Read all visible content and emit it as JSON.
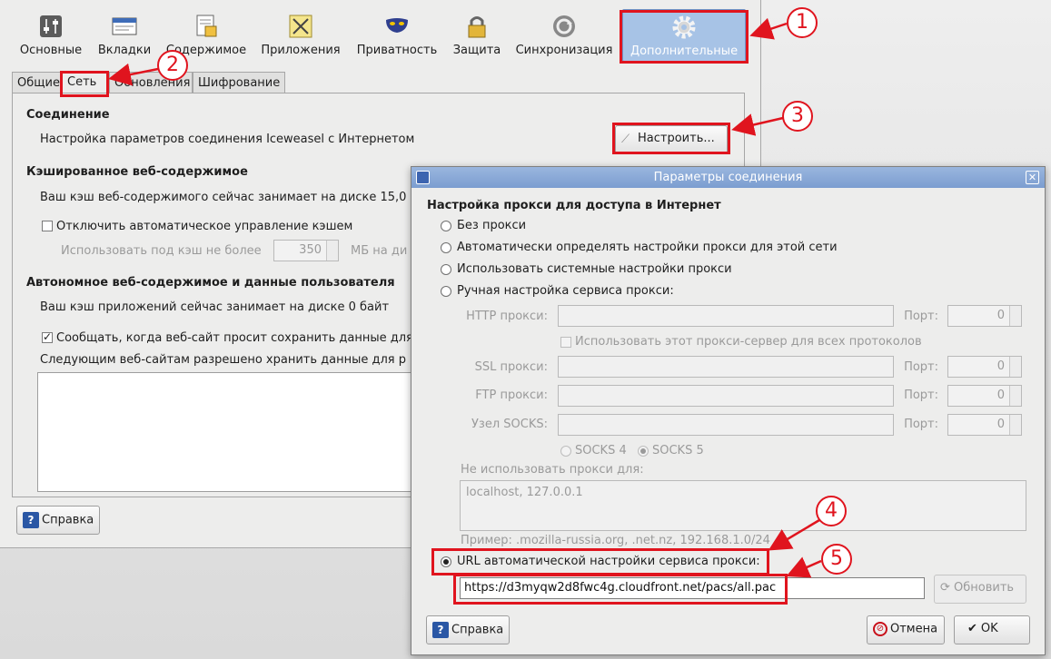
{
  "toolbar": {
    "items": [
      {
        "label": "Основные",
        "icon": "sliders-icon"
      },
      {
        "label": "Вкладки",
        "icon": "tabs-icon"
      },
      {
        "label": "Содержимое",
        "icon": "content-icon"
      },
      {
        "label": "Приложения",
        "icon": "applications-icon"
      },
      {
        "label": "Приватность",
        "icon": "mask-icon"
      },
      {
        "label": "Защита",
        "icon": "lock-icon"
      },
      {
        "label": "Синхронизация",
        "icon": "sync-icon"
      },
      {
        "label": "Дополнительные",
        "icon": "gear-icon"
      }
    ]
  },
  "tabs": [
    {
      "label": "Общие"
    },
    {
      "label": "Сеть"
    },
    {
      "label": "Обновления"
    },
    {
      "label": "Шифрование"
    }
  ],
  "network": {
    "connection_heading": "Соединение",
    "connection_text": "Настройка параметров соединения Iceweasel с Интернетом",
    "configure_button": "Настроить...",
    "cache_heading": "Кэшированное веб-содержимое",
    "cache_text": "Ваш кэш веб-содержимого сейчас занимает на диске 15,0",
    "cache_override_label": "Отключить автоматическое управление кэшем",
    "cache_limit_label": "Использовать под кэш не более",
    "cache_limit_value": "350",
    "cache_limit_unit": "МБ на ди",
    "offline_heading": "Автономное веб-содержимое и данные пользователя",
    "offline_text": "Ваш кэш приложений сейчас занимает на диске 0 байт",
    "notify_label": "Сообщать, когда веб-сайт просит сохранить данные для",
    "allowed_label": "Следующим веб-сайтам разрешено хранить данные для р",
    "help_button": "Справка"
  },
  "dialog": {
    "title": "Параметры соединения",
    "heading": "Настройка прокси для доступа в Интернет",
    "options": {
      "no_proxy": "Без прокси",
      "auto_detect": "Автоматически определять настройки прокси для этой сети",
      "system": "Использовать системные настройки прокси",
      "manual": "Ручная настройка сервиса прокси:",
      "pac": "URL автоматической настройки сервиса прокси:"
    },
    "http_label": "HTTP прокси:",
    "ssl_label": "SSL прокси:",
    "ftp_label": "FTP прокси:",
    "socks_label": "Узел SOCKS:",
    "port_label": "Порт:",
    "port_value": "0",
    "share_label": "Использовать этот прокси-сервер для всех протоколов",
    "socks4": "SOCKS 4",
    "socks5": "SOCKS 5",
    "no_proxy_for_label": "Не использовать прокси для:",
    "no_proxy_for_value": "localhost, 127.0.0.1",
    "example": "Пример: .mozilla-russia.org, .net.nz, 192.168.1.0/24",
    "pac_url": "https://d3myqw2d8fwc4g.cloudfront.net/pacs/all.pac",
    "reload_button": "Обновить",
    "help_button": "Справка",
    "cancel_button": "Отмена",
    "ok_button": "OK"
  },
  "annotations": [
    "1",
    "2",
    "3",
    "4",
    "5"
  ],
  "colors": {
    "annotation": "#e0141e",
    "active_tab": "#a7c3e6",
    "title_bar": "#7b9dd0"
  }
}
